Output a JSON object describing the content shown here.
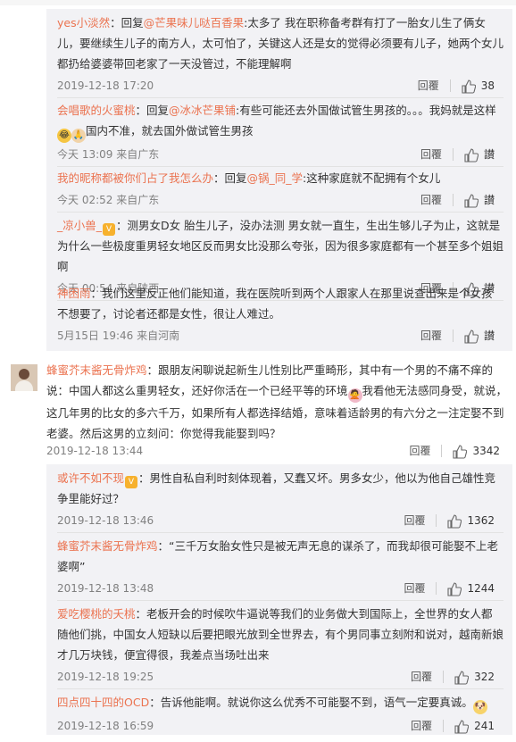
{
  "replies_top": [
    {
      "user": "yes小淡然",
      "text_pre": "：回复",
      "mention": "@芒果味儿哒百香果",
      "text": ":太多了 我在职称备考群有打了一胎女儿生了俩女儿，要继续生儿子的南方人，太可怕了，关键这人还是女的觉得必须要有儿子，她两个女儿都扔给婆婆带回老家了一天没管过，不能理解啊",
      "time": "2019-12-18 17:20",
      "reply": "回覆",
      "likes": "38"
    },
    {
      "user": "会唱歌的火蜜桃",
      "text_pre": "：回复",
      "mention": "@冰冰芒果铺",
      "text": ":有些可能还去外国做试管生男孩的。。。我妈就是这样",
      "text2": "国内不准，就去国外做试管生男孩",
      "time": "今天 13:09 来自广东",
      "reply": "回覆",
      "likes": "讃"
    },
    {
      "user": "我的昵称都被你们占了我怎么办",
      "text_pre": "：回复",
      "mention": "@锅_同_学",
      "text": ":这种家庭就不配拥有个女儿",
      "time": "今天 02:52 来自广东",
      "reply": "回覆",
      "likes": "讃"
    },
    {
      "user": "_凉小兽_",
      "text": "：测男女D女 胎生儿子，没办法测 男女就一直生，生出生够儿子为止，这就是为什么一些极度重男轻女地区反而男女比没那么夸张，因为很多家庭都有一个甚至多个姐姐啊",
      "time": "今天 00:54 来自陕西",
      "reply": "回覆",
      "likes": "讃"
    },
    {
      "user": "神困雨",
      "text": "：我们这里反正他们能知道，我在医院听到两个人跟家人在那里说查出来是个女孩不想要了，讨论者还都是女性，很让人难过。",
      "time": "5月15日 19:46 来自河南",
      "reply": "回覆",
      "likes": "讃"
    }
  ],
  "main_comment": {
    "user": "蜂蜜芥末酱无骨炸鸡",
    "text": "：跟朋友闲聊说起新生儿性别比严重畸形，其中有一个男的不痛不痒的说：中国人都这么重男轻女，还好你活在一个已经平等的环境",
    "text2": "我看他无法感同身受，就说，这几年男的比女的多六千万，如果所有人都选择结婚，意味着适龄男的有六分之一注定娶不到老婆。然后这男的立刻问：你觉得我能娶到吗？",
    "time": "2019-12-18 13:44",
    "reply": "回覆",
    "likes": "3342"
  },
  "replies_bottom": [
    {
      "user": "或许不如不现",
      "text": "：男性自私自利时刻体现着，又蠢又坏。男多女少，他以为他自己雄性竞争里能好过？",
      "time": "2019-12-18 13:46",
      "reply": "回覆",
      "likes": "1362"
    },
    {
      "user": "蜂蜜芥末酱无骨炸鸡",
      "text": "：“三千万女胎女性只是被无声无息的谋杀了，而我却很可能娶不上老婆啊”",
      "time": "2019-12-18 13:48",
      "reply": "回覆",
      "likes": "1244"
    },
    {
      "user": "爱吃樱桃的夭桃",
      "text": "：老板开会的时候吹牛逼说等我们的业务做大到国际上，全世界的女人都随他们挑，中国女人短缺以后要把眼光放到全世界去，有个男同事立刻附和说对，越南新娘才几万块钱，便宜得很，我差点当场吐出来",
      "time": "2019-12-18 19:25",
      "reply": "回覆",
      "likes": "322"
    },
    {
      "user": "四点四十四的OCD",
      "text": "：告诉他能啊。就说你这么优秀不可能娶不到，语气一定要真诚。",
      "time": "2019-12-18 16:59",
      "reply": "回覆",
      "likes": "241"
    }
  ],
  "colors": {
    "username": "#eb7350",
    "reply_bg": "#f2f2f5",
    "meta": "#808080"
  }
}
